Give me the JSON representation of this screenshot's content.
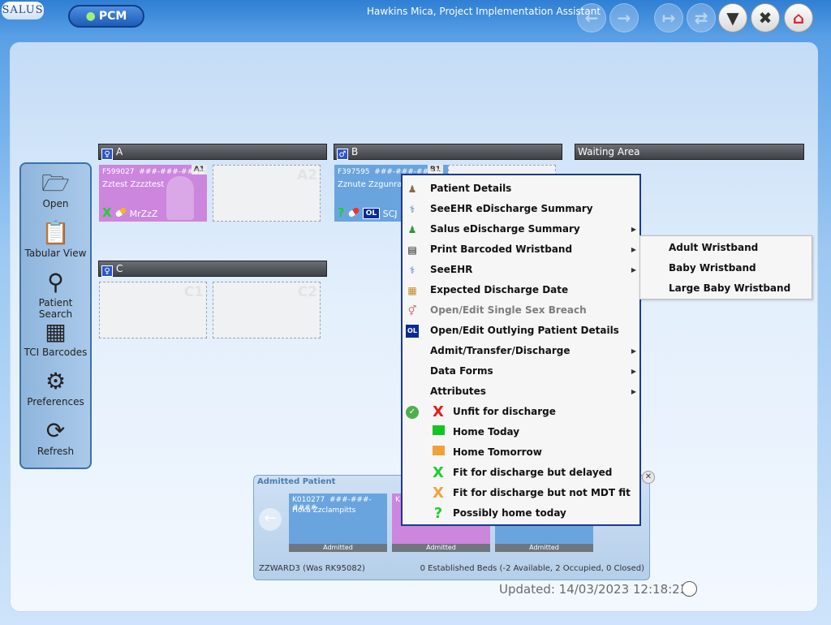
{
  "header": {
    "logo": "SALUS",
    "module_button": "PCM",
    "user_title": "Hawkins Mica, Project Implementation Assistant"
  },
  "sidebar": {
    "items": [
      {
        "label": "Open",
        "icon": "folder-icon"
      },
      {
        "label": "Tabular View",
        "icon": "clipboard-icon"
      },
      {
        "label": "Patient Search",
        "icon": "magnifier-icon"
      },
      {
        "label": "TCI Barcodes",
        "icon": "qr-code-icon"
      },
      {
        "label": "Preferences",
        "icon": "gear-icon"
      },
      {
        "label": "Refresh",
        "icon": "refresh-icon"
      }
    ]
  },
  "bays": {
    "a": {
      "label": "A"
    },
    "b": {
      "label": "B"
    },
    "c": {
      "label": "C"
    },
    "waiting": {
      "label": "Waiting Area"
    }
  },
  "beds": {
    "a1": {
      "label": "A1",
      "id": "F599027",
      "nhs": "###-###-####",
      "name": "Zztest Zzzztest",
      "consultant": "MrZzZ",
      "color": "#cc86de"
    },
    "a2": {
      "label": "A2"
    },
    "b1": {
      "label": "B1",
      "id": "F397595",
      "nhs": "###-###-####",
      "name": "Zznute Zzgunray",
      "extra": "SCJ",
      "badge": "OL",
      "color": "#6aa4df"
    },
    "c1": {
      "label": "C1"
    },
    "c2": {
      "label": "C2"
    }
  },
  "context_menu": {
    "items": [
      {
        "label": "Patient Details"
      },
      {
        "label": "SeeEHR eDischarge Summary"
      },
      {
        "label": "Salus eDischarge Summary"
      },
      {
        "label": "Print Barcoded Wristband"
      },
      {
        "label": "SeeEHR"
      },
      {
        "label": "Expected Discharge Date"
      },
      {
        "label": "Open/Edit Single Sex Breach"
      },
      {
        "label": "Open/Edit Outlying Patient Details"
      },
      {
        "label": "Admit/Transfer/Discharge"
      },
      {
        "label": "Data Forms"
      },
      {
        "label": "Attributes"
      },
      {
        "label": "Unfit for discharge"
      },
      {
        "label": "Home Today"
      },
      {
        "label": "Home Tomorrow"
      },
      {
        "label": "Fit for discharge but delayed"
      },
      {
        "label": "Fit for discharge but not MDT fit"
      },
      {
        "label": "Possibly home today"
      }
    ]
  },
  "submenu": {
    "items": [
      {
        "label": "Adult Wristband"
      },
      {
        "label": "Baby Wristband"
      },
      {
        "label": "Large Baby Wristband"
      }
    ]
  },
  "admitted": {
    "title": "Admitted Patient",
    "cards": [
      {
        "id": "K010277",
        "nhs": "###-###-####",
        "name": "Hoka Zzclampitts",
        "status": "Admitted",
        "color": "#6aa4df"
      },
      {
        "id": "K",
        "name": "",
        "status": "Admitted",
        "color": "#cc86de"
      },
      {
        "id": "",
        "name": "",
        "status": "Admitted",
        "color": "#6aa4df"
      }
    ],
    "ward": "ZZWARD3 (Was RK95082)",
    "beds_summary": "0 Established Beds (-2 Available, 2 Occupied, 0 Closed)"
  },
  "status": {
    "updated": "Updated: 14/03/2023 12:18:23"
  },
  "colors": {
    "accent": "#1d5cb8",
    "female_bed": "#cc86de",
    "male_bed": "#6aa4df",
    "home_today": "#11c621",
    "home_tomorrow": "#f3a03a",
    "unfit": "#e61b1b"
  }
}
